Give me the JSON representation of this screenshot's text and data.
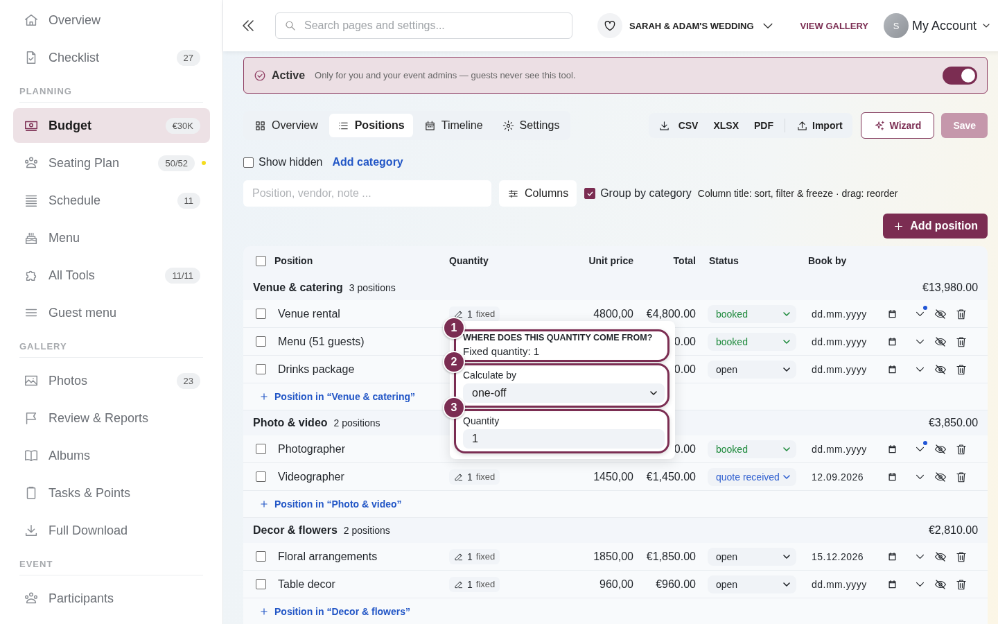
{
  "sidebar": {
    "sections": [
      {
        "items": [
          {
            "label": "Overview",
            "selected": false
          },
          {
            "label": "Checklist",
            "badge": "27",
            "selected": false
          }
        ]
      },
      {
        "heading": "PLANNING",
        "items": [
          {
            "label": "Budget",
            "badge": "€30K",
            "selected": true
          },
          {
            "label": "Seating Plan",
            "badge": "50/52",
            "color": "#f5dc1e",
            "selected": false
          },
          {
            "label": "Schedule",
            "badge": "11",
            "selected": false
          },
          {
            "label": "Menu",
            "selected": false
          },
          {
            "label": "All Tools",
            "badge": "11/11",
            "selected": false
          },
          {
            "label": "Guest menu",
            "selected": false
          }
        ]
      },
      {
        "heading": "GALLERY",
        "items": [
          {
            "label": "Photos",
            "badge": "23",
            "selected": false
          },
          {
            "label": "Review & Reports",
            "selected": false
          },
          {
            "label": "Albums",
            "selected": false
          },
          {
            "label": "Tasks & Points",
            "selected": false
          },
          {
            "label": "Full Download",
            "selected": false
          }
        ]
      },
      {
        "heading": "EVENT",
        "items": [
          {
            "label": "Participants",
            "selected": false
          }
        ]
      }
    ]
  },
  "header": {
    "search": {
      "placeholder": "Search pages and settings..."
    },
    "event": "SARAH & ADAM'S WEDDING",
    "gallery_link": "VIEW GALLERY",
    "avatar": "S",
    "account": "My Account"
  },
  "banner": {
    "status": "Active",
    "text": "Only for you and your event admins — guests never see this tool.",
    "on": true
  },
  "tabs": [
    {
      "label": "Overview",
      "selected": false
    },
    {
      "label": "Positions",
      "selected": true
    },
    {
      "label": "Timeline",
      "selected": false
    },
    {
      "label": "Settings",
      "selected": false
    }
  ],
  "exports": [
    "CSV",
    "XLSX",
    "PDF"
  ],
  "import": "Import",
  "wizard": "Wizard",
  "save": {
    "label": "Save",
    "disabled": true
  },
  "show_hidden": {
    "label": "Show hidden",
    "checked": false
  },
  "add_category": "Add category",
  "filter": {
    "placeholder": "Position, vendor, note ..."
  },
  "columns_button": "Columns",
  "group_by": {
    "label": "Group by category",
    "checked": true
  },
  "hint": "Column title: sort, filter & freeze · drag: reorder",
  "add_position": "Add position",
  "table": {
    "select_all": {
      "checked": false
    },
    "columns": [
      "Position",
      "Quantity",
      "Unit price",
      "Total",
      "Status",
      "Book by"
    ],
    "groups": [
      {
        "name": "Venue & catering",
        "count": "3 positions",
        "total": "€13,980.00",
        "add": "Position in “Venue & catering”",
        "rows": [
          {
            "name": "Venue rental",
            "checked": false,
            "quantity": {
              "value": "1",
              "unit": "fixed"
            },
            "unit_price": "4800,00",
            "total": "€4,800.00",
            "status": {
              "label": "booked",
              "color": "#1e8a3c"
            },
            "book_by": {
              "placeholder": "dd.mm.yyyy"
            },
            "note": true
          },
          {
            "name": "Menu (51 guests)",
            "checked": false,
            "total": "0.00",
            "status": {
              "label": "booked",
              "color": "#1e8a3c"
            },
            "book_by": {
              "placeholder": "dd.mm.yyyy"
            },
            "note": false
          },
          {
            "name": "Drinks package",
            "checked": false,
            "total": "0.00",
            "status": {
              "label": "open",
              "color": "#1f2328"
            },
            "book_by": {
              "placeholder": "dd.mm.yyyy"
            },
            "note": false
          }
        ]
      },
      {
        "name": "Photo & video",
        "count": "2 positions",
        "total": "€3,850.00",
        "add": "Position in “Photo & video”",
        "rows": [
          {
            "name": "Photographer",
            "checked": false,
            "total": "0.00",
            "status": {
              "label": "booked",
              "color": "#1e8a3c"
            },
            "book_by": {
              "placeholder": "dd.mm.yyyy"
            },
            "note": true
          },
          {
            "name": "Videographer",
            "checked": false,
            "quantity": {
              "value": "1",
              "unit": "fixed"
            },
            "unit_price": "1450,00",
            "total": "€1,450.00",
            "status": {
              "label": "quote received",
              "color": "#2f5fd0"
            },
            "book_by": {
              "value": "12.09.2026"
            },
            "note": false
          }
        ]
      },
      {
        "name": "Decor & flowers",
        "count": "2 positions",
        "total": "€2,810.00",
        "add": "Position in “Decor & flowers”",
        "rows": [
          {
            "name": "Floral arrangements",
            "checked": false,
            "quantity": {
              "value": "1",
              "unit": "fixed"
            },
            "unit_price": "1850,00",
            "total": "€1,850.00",
            "status": {
              "label": "open",
              "color": "#1f2328"
            },
            "book_by": {
              "value": "15.12.2026"
            },
            "note": false
          },
          {
            "name": "Table decor",
            "checked": false,
            "quantity": {
              "value": "1",
              "unit": "fixed"
            },
            "unit_price": "960,00",
            "total": "€960.00",
            "status": {
              "label": "open",
              "color": "#1f2328"
            },
            "book_by": {
              "placeholder": "dd.mm.yyyy"
            },
            "note": false
          }
        ]
      }
    ]
  },
  "popover": {
    "steps": [
      {
        "kind": "info",
        "number": "1",
        "title": "WHERE DOES THIS QUANTITY COME FROM?",
        "text": "Fixed quantity: 1"
      },
      {
        "kind": "select",
        "number": "2",
        "label": "Calculate by",
        "value": "one-off"
      },
      {
        "kind": "input",
        "number": "3",
        "label": "Quantity",
        "value": "1"
      }
    ]
  }
}
